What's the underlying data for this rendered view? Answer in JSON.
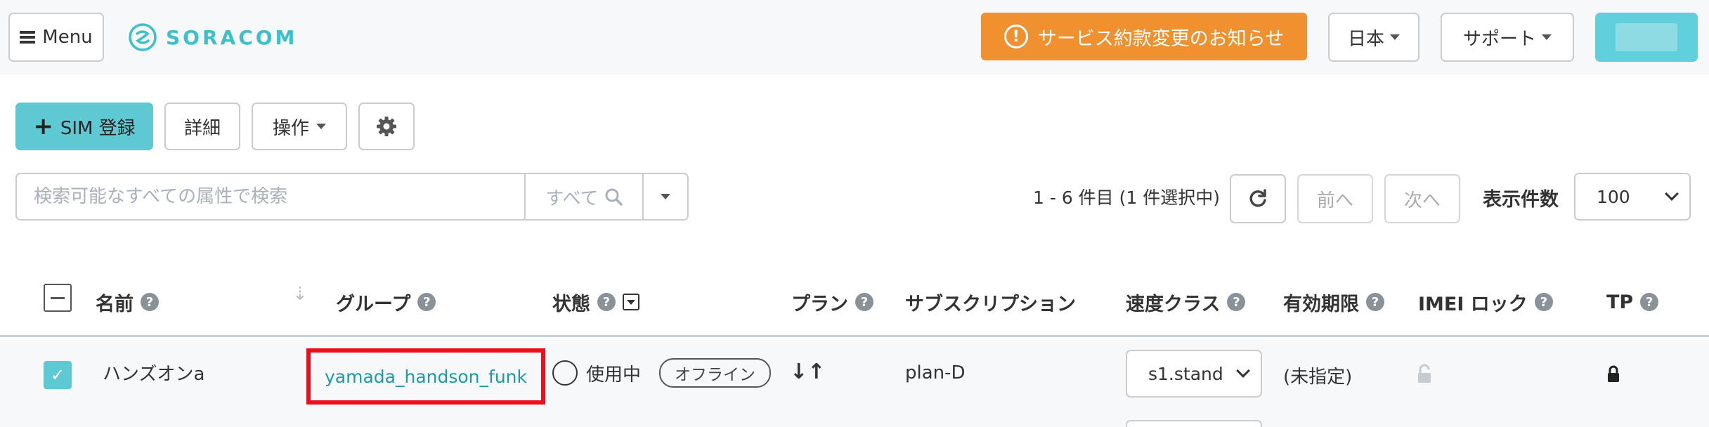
{
  "navbar": {
    "menu_label": "Menu",
    "logo_text": "SORACOM",
    "notice_label": "サービス約款変更のお知らせ",
    "notice_icon_glyph": "!",
    "language_label": "日本",
    "support_label": "サポート"
  },
  "toolbar": {
    "sim_register_label": "SIM 登録",
    "detail_label": "詳細",
    "operations_label": "操作"
  },
  "search": {
    "placeholder": "検索可能なすべての属性で検索",
    "scope_label": "すべて"
  },
  "paging": {
    "info": "1 - 6 件目 (1 件選択中)",
    "prev_label": "前へ",
    "next_label": "次へ",
    "per_page_label": "表示件数",
    "per_page_value": "100"
  },
  "table": {
    "headers": {
      "name": "名前",
      "group": "グループ",
      "status": "状態",
      "plan": "プラン",
      "subscription": "サブスクリプション",
      "speed_class": "速度クラス",
      "expiry": "有効期限",
      "imei_lock": "IMEI ロック",
      "tp": "TP"
    },
    "rows": [
      {
        "selected": true,
        "name": "ハンズオンa",
        "group": "yamada_handson_funk",
        "status": "使用中",
        "session": "オフライン",
        "subscription": "plan-D",
        "speed_class": "s1.stand",
        "expiry": "(未指定)"
      }
    ]
  },
  "colors": {
    "accent": "#5fc9d3",
    "notice": "#f0902e",
    "highlight_border": "#e8101a",
    "link": "#1d9aa6"
  },
  "icons": [
    "hamburger-icon",
    "soracom-logo-icon",
    "alert-circle-icon",
    "plus-icon",
    "gear-icon",
    "search-icon",
    "refresh-icon",
    "help-icon",
    "filter-icon",
    "sort-icon",
    "check-icon",
    "lock-open-icon",
    "lock-icon"
  ]
}
